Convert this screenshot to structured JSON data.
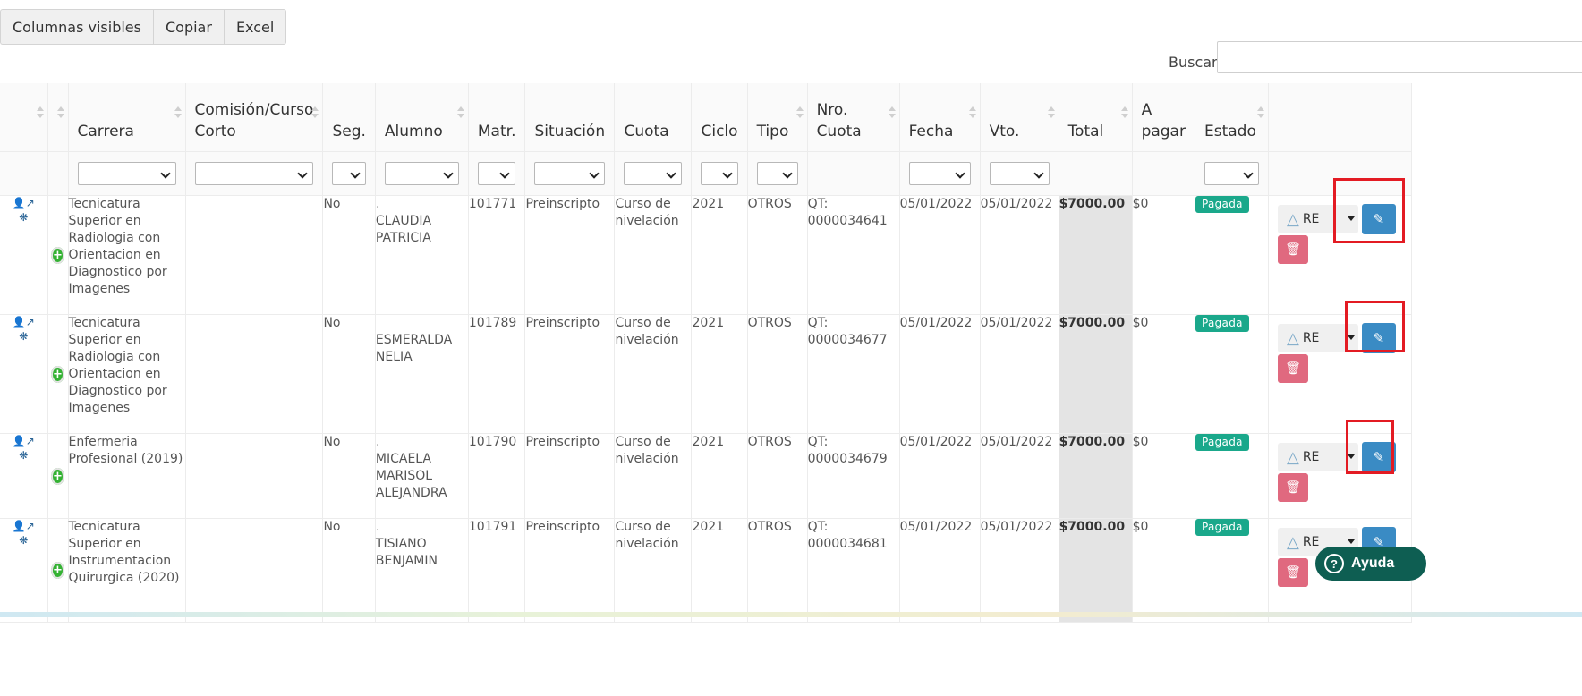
{
  "toolbar": {
    "buttons": [
      "Columnas visibles",
      "Copiar",
      "Excel"
    ],
    "search_label": "Buscar:",
    "search_value": ""
  },
  "table": {
    "headers": {
      "carrera": "Carrera",
      "comision": "Comisión/Curso Corto",
      "seg": "Seg.",
      "alumno": "Alumno",
      "matr": "Matr.",
      "situacion": "Situación",
      "cuota": "Cuota",
      "ciclo": "Ciclo",
      "tipo": "Tipo",
      "nro_cuota": "Nro. Cuota",
      "fecha": "Fecha",
      "vto": "Vto.",
      "total": "Total",
      "a_pagar": "A pagar",
      "estado": "Estado"
    },
    "rows": [
      {
        "carrera": "Tecnicatura Superior en Radiologia con Orientacion en Diagnostico por Imagenes",
        "comision": "",
        "seg": "No",
        "alumno_prefix": ".",
        "alumno": "CLAUDIA PATRICIA",
        "matr": "101771",
        "situacion": "Preinscripto",
        "cuota": "Curso de nivelación",
        "ciclo": "2021",
        "tipo": "OTROS",
        "nro_cuota": "QT: 0000034641",
        "fecha": "05/01/2022",
        "vto": "05/01/2022",
        "total": "$7000.00",
        "a_pagar": "$0",
        "estado": "Pagada",
        "action_label": "RE"
      },
      {
        "carrera": "Tecnicatura Superior en Radiologia con Orientacion en Diagnostico por Imagenes",
        "comision": "",
        "seg": "No",
        "alumno_prefix": "",
        "alumno": "ESMERALDA NELIA",
        "matr": "101789",
        "situacion": "Preinscripto",
        "cuota": "Curso de nivelación",
        "ciclo": "2021",
        "tipo": "OTROS",
        "nro_cuota": "QT: 0000034677",
        "fecha": "05/01/2022",
        "vto": "05/01/2022",
        "total": "$7000.00",
        "a_pagar": "$0",
        "estado": "Pagada",
        "action_label": "RE"
      },
      {
        "carrera": "Enfermeria Profesional (2019)",
        "comision": "",
        "seg": "No",
        "alumno_prefix": ".",
        "alumno": "MICAELA MARISOL ALEJANDRA",
        "matr": "101790",
        "situacion": "Preinscripto",
        "cuota": "Curso de nivelación",
        "ciclo": "2021",
        "tipo": "OTROS",
        "nro_cuota": "QT: 0000034679",
        "fecha": "05/01/2022",
        "vto": "05/01/2022",
        "total": "$7000.00",
        "a_pagar": "$0",
        "estado": "Pagada",
        "action_label": "RE"
      },
      {
        "carrera": "Tecnicatura Superior en Instrumentacion Quirurgica (2020)",
        "comision": "",
        "seg": "No",
        "alumno_prefix": ".",
        "alumno": "TISIANO BENJAMIN",
        "matr": "101791",
        "situacion": "Preinscripto",
        "cuota": "Curso de nivelación",
        "ciclo": "2021",
        "tipo": "OTROS",
        "nro_cuota": "QT: 0000034681",
        "fecha": "05/01/2022",
        "vto": "05/01/2022",
        "total": "$7000.00",
        "a_pagar": "$0",
        "estado": "Pagada",
        "action_label": "RE"
      }
    ]
  },
  "help": {
    "label": "Ayuda"
  },
  "colors": {
    "badge": "#1aa88b",
    "edit_button": "#3a8bc4",
    "delete_button": "#e0697f",
    "highlight": "#e31b23",
    "help_button": "#0e5e52"
  },
  "icons": [
    "user-icon",
    "external-link-icon",
    "bug-icon",
    "plus-circle-icon",
    "edit-icon",
    "trash-icon",
    "help-icon"
  ]
}
